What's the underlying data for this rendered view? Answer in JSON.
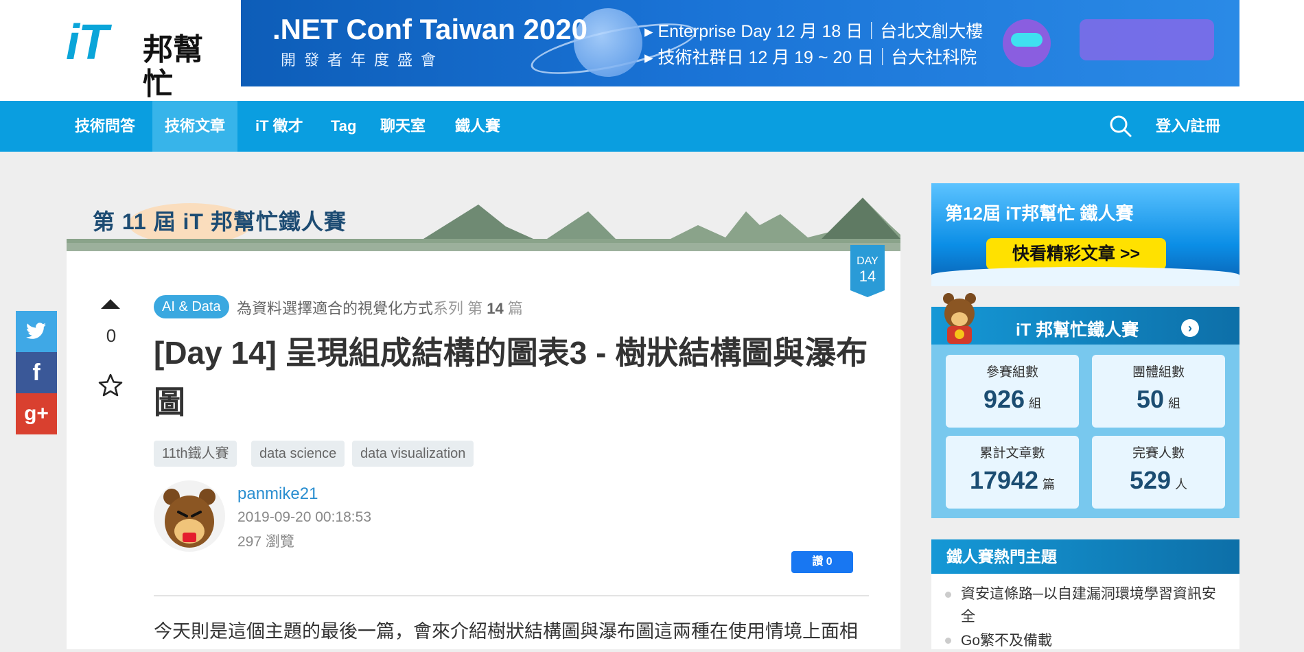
{
  "header": {
    "logo_it": "iT",
    "logo_bm": "邦幫忙"
  },
  "banner": {
    "title": ".NET Conf Taiwan 2020",
    "subtitle": "開發者年度盛會",
    "line1": "▸ Enterprise Day 12 月 18 日｜台北文創大樓",
    "line2": "▸ 技術社群日 12 月 19 ~ 20 日｜台大社科院"
  },
  "nav": {
    "items": [
      "技術問答",
      "技術文章",
      "iT 徵才",
      "Tag",
      "聊天室",
      "鐵人賽"
    ],
    "active_index": 1,
    "login": "登入/註冊",
    "search_icon": "search-icon"
  },
  "ironman": {
    "header": "第 11 屆 iT 邦幫忙鐵人賽"
  },
  "article": {
    "day_label": "DAY",
    "day_number": "14",
    "vote_count": "0",
    "category": "AI & Data",
    "series_name": "為資料選擇適合的視覺化方式",
    "series_word": "系列",
    "series_prefix": "第",
    "series_num": "14",
    "series_suffix": "篇",
    "title": "[Day 14] 呈現組成結構的圖表3 - 樹狀結構圖與瀑布圖",
    "tags": [
      "11th鐵人賽",
      "data science",
      "data visualization"
    ],
    "author": "panmike21",
    "date": "2019-09-20 00:18:53",
    "views": "297 瀏覽",
    "like_label": "讚 0",
    "body_preview": "今天則是這個主題的最後一篇，會來介紹樹狀結構圖與瀑布圖這兩種在使用情境上面相"
  },
  "share": {
    "twitter_icon": "twitter-icon",
    "facebook_icon": "facebook-icon",
    "gplus_icon": "google-plus-icon",
    "fb_glyph": "f",
    "gp_glyph": "g+"
  },
  "sidebar": {
    "ad": {
      "edition": "第12屆 iT邦幫忙 鐵人賽",
      "cta": "快看精彩文章 >>"
    },
    "stats": {
      "title": "iT 邦幫忙鐵人賽",
      "items": [
        {
          "label": "參賽組數",
          "value": "926",
          "unit": "組"
        },
        {
          "label": "團體組數",
          "value": "50",
          "unit": "組"
        },
        {
          "label": "累計文章數",
          "value": "17942",
          "unit": "篇"
        },
        {
          "label": "完賽人數",
          "value": "529",
          "unit": "人"
        }
      ]
    },
    "hot": {
      "title": "鐵人賽熱門主題",
      "items": [
        "資安這條路─以自建漏洞環境學習資訊安全",
        "Go繁不及備載"
      ]
    }
  },
  "colors": {
    "primary": "#0a9ee0",
    "active_nav": "#37b4ea",
    "badge": "#3aa8e0",
    "twitter": "#3fa8e6",
    "facebook": "#3a5898",
    "gplus": "#d9402f"
  }
}
